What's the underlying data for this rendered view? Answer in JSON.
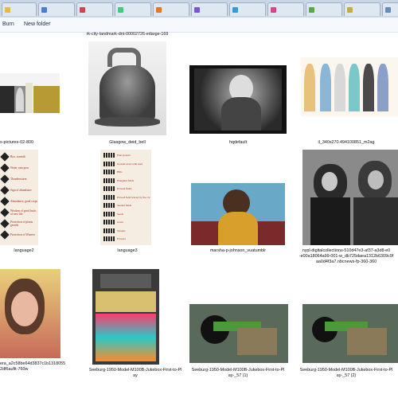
{
  "toolbar": {
    "burn_label": "Burn",
    "new_folder_label": "New folder"
  },
  "files": {
    "f00": {
      "caption": "rk-city-landmark-dnt-00002726-edarge-169"
    },
    "f01": {
      "caption": "s-pictures-02-800"
    },
    "f02": {
      "caption": "Glasgow_deid_bell"
    },
    "f03": {
      "caption": "hqdefault"
    },
    "f04": {
      "caption": "il_340x270.494100851_m2ag"
    },
    "f05": {
      "caption": "language2"
    },
    "f06": {
      "caption": "language3"
    },
    "f07": {
      "caption": "marsha-p-johnson_vuatumblr"
    },
    "f08": {
      "caption_line1": "nypl-digitalcollections-510d47e3-af37-a3d8-e0",
      "caption_line2": "-e00a18064a99-001-w_db725daea1312b6309c9f",
      "caption_line3": "aa0d4f3a7.nbcnews-fp-360-360"
    },
    "f09": {
      "caption_line1": "era_a2c58be64d3837c1b1318055",
      "caption_line2": "2df6aufit-760w"
    },
    "f10": {
      "caption_line1": "Seeburg-1950-Model-M100B-Jukebox-First-to-Pl",
      "caption_line2": "ay"
    },
    "f11": {
      "caption_line1": "Seeburg-1950-Model-M100B-Jukebox-First-to-Pl",
      "caption_line2": "ay-_57 (1)"
    },
    "f12": {
      "caption_line1": "Seeburg-1950-Model-M100B-Jukebox-First-to-Pl",
      "caption_line2": "ay-_57 (2)"
    }
  },
  "language_strips": {
    "symbols": [
      "Box, warmth",
      "Water, rain pour",
      "Thunderstorm",
      "Sign of abundance",
      "Abundance, good crops",
      "Wisdom of good fruits of new life",
      "Protection of plants growth",
      "Protection of Women"
    ],
    "headers": [
      "Fine ground",
      "Ground sown with seed",
      "Hills",
      "Ploughed fields",
      "Plowed fields",
      "Plowed field fenced by the cor",
      "Seeded fields",
      "Seeds",
      "Grain",
      "Sprouts",
      "Flowers"
    ]
  }
}
